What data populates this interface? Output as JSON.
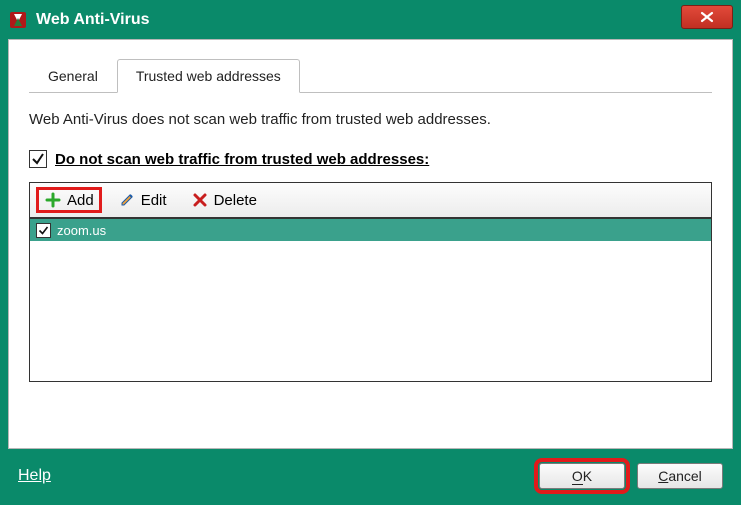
{
  "window": {
    "title": "Web Anti-Virus"
  },
  "tabs": {
    "general": "General",
    "trusted": "Trusted web addresses"
  },
  "description": "Web Anti-Virus does not scan web traffic from trusted web addresses.",
  "checkbox": {
    "label": "Do not scan web traffic from trusted web addresses:"
  },
  "toolbar": {
    "add": "Add",
    "edit": "Edit",
    "delete": "Delete"
  },
  "list": {
    "rows": [
      {
        "label": "zoom.us",
        "checked": true
      }
    ]
  },
  "footer": {
    "help": "Help",
    "ok": "OK",
    "cancel": "Cancel"
  }
}
